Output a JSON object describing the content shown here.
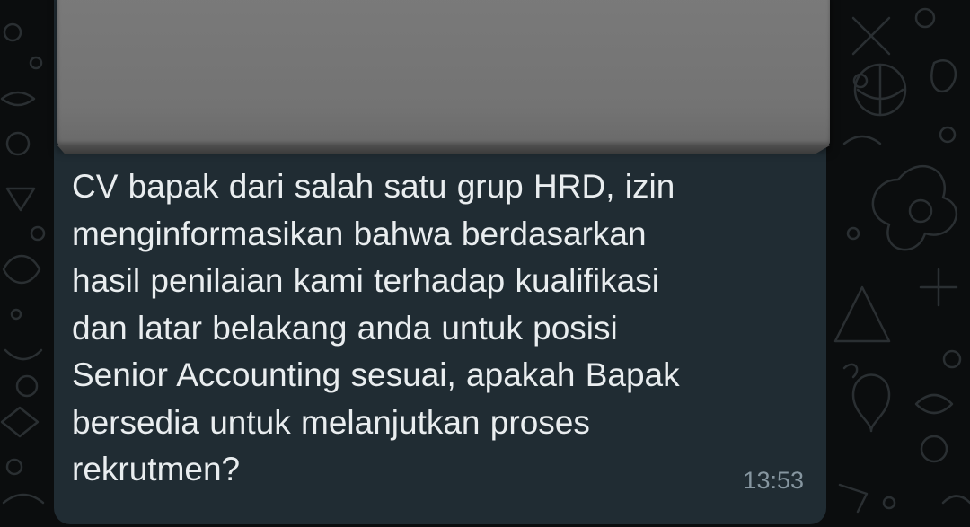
{
  "message": {
    "text": "CV bapak dari salah satu grup HRD, izin\nmenginformasikan bahwa berdasarkan\nhasil penilaian kami terhadap kualifikasi\ndan latar belakang anda untuk posisi\nSenior Accounting sesuai, apakah Bapak\nbersedia untuk melanjutkan proses\nrekrutmen?",
    "time": "13:53"
  },
  "colors": {
    "background": "#0b0d0e",
    "bubble": "#202c33",
    "text": "#e9edef",
    "timestamp": "#8696a0",
    "redaction": "#777777"
  },
  "icons": [
    "doodle-wallpaper-icon"
  ]
}
